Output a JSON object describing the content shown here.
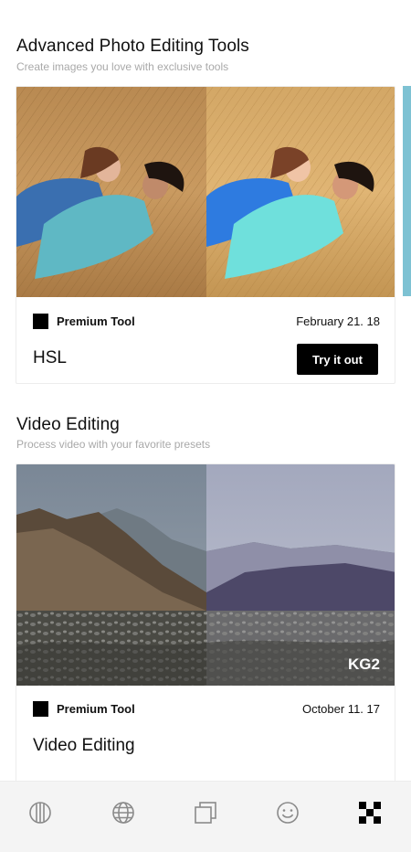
{
  "sections": [
    {
      "title": "Advanced Photo Editing Tools",
      "subtitle": "Create images you love with exclusive tools",
      "card": {
        "badge": "Premium Tool",
        "date": "February 21. 18",
        "name": "HSL",
        "action": "Try it out"
      }
    },
    {
      "title": "Video Editing",
      "subtitle": "Process video with your favorite presets",
      "card": {
        "badge": "Premium Tool",
        "date": "October 11. 17",
        "name": "Video Editing",
        "watermark": "KG2"
      }
    }
  ],
  "tabbar": {
    "icons": [
      "studio-icon",
      "globe-icon",
      "library-icon",
      "smiley-icon",
      "grid-icon"
    ],
    "active_color": "#000000",
    "inactive_color": "#8a8a8a"
  },
  "colors": {
    "accent": "#000000",
    "peek": "#7ec2d3"
  }
}
